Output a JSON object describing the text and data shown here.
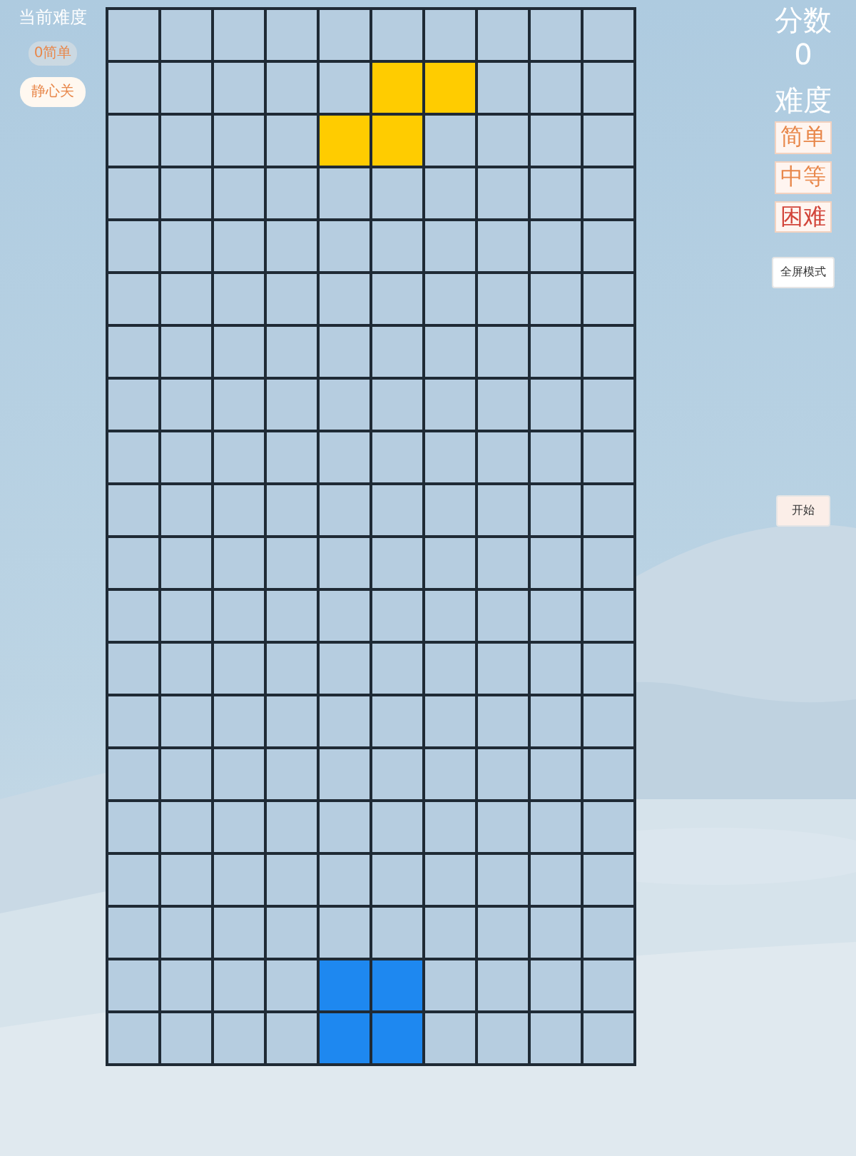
{
  "left_panel": {
    "title": "当前难度",
    "current_level": "0简单",
    "mode_button": "静心关"
  },
  "board": {
    "rows": [
      [
        {
          "filled": false
        },
        {
          "filled": false
        },
        {
          "filled": false
        },
        {
          "filled": false
        },
        {
          "filled": false
        },
        {
          "filled": false
        },
        {
          "filled": false
        },
        {
          "filled": false
        },
        {
          "filled": false
        },
        {
          "filled": false
        }
      ],
      [
        {
          "filled": false
        },
        {
          "filled": false
        },
        {
          "filled": false
        },
        {
          "filled": false
        },
        {
          "filled": false
        },
        {
          "filled": true,
          "color": "#ffcc00"
        },
        {
          "filled": true,
          "color": "#ffcc00"
        },
        {
          "filled": false
        },
        {
          "filled": false
        },
        {
          "filled": false
        }
      ],
      [
        {
          "filled": false
        },
        {
          "filled": false
        },
        {
          "filled": false
        },
        {
          "filled": false
        },
        {
          "filled": true,
          "color": "#ffcc00"
        },
        {
          "filled": true,
          "color": "#ffcc00"
        },
        {
          "filled": false
        },
        {
          "filled": false
        },
        {
          "filled": false
        },
        {
          "filled": false
        }
      ],
      [
        {
          "filled": false
        },
        {
          "filled": false
        },
        {
          "filled": false
        },
        {
          "filled": false
        },
        {
          "filled": false
        },
        {
          "filled": false
        },
        {
          "filled": false
        },
        {
          "filled": false
        },
        {
          "filled": false
        },
        {
          "filled": false
        }
      ],
      [
        {
          "filled": false
        },
        {
          "filled": false
        },
        {
          "filled": false
        },
        {
          "filled": false
        },
        {
          "filled": false
        },
        {
          "filled": false
        },
        {
          "filled": false
        },
        {
          "filled": false
        },
        {
          "filled": false
        },
        {
          "filled": false
        }
      ],
      [
        {
          "filled": false
        },
        {
          "filled": false
        },
        {
          "filled": false
        },
        {
          "filled": false
        },
        {
          "filled": false
        },
        {
          "filled": false
        },
        {
          "filled": false
        },
        {
          "filled": false
        },
        {
          "filled": false
        },
        {
          "filled": false
        }
      ],
      [
        {
          "filled": false
        },
        {
          "filled": false
        },
        {
          "filled": false
        },
        {
          "filled": false
        },
        {
          "filled": false
        },
        {
          "filled": false
        },
        {
          "filled": false
        },
        {
          "filled": false
        },
        {
          "filled": false
        },
        {
          "filled": false
        }
      ],
      [
        {
          "filled": false
        },
        {
          "filled": false
        },
        {
          "filled": false
        },
        {
          "filled": false
        },
        {
          "filled": false
        },
        {
          "filled": false
        },
        {
          "filled": false
        },
        {
          "filled": false
        },
        {
          "filled": false
        },
        {
          "filled": false
        }
      ],
      [
        {
          "filled": false
        },
        {
          "filled": false
        },
        {
          "filled": false
        },
        {
          "filled": false
        },
        {
          "filled": false
        },
        {
          "filled": false
        },
        {
          "filled": false
        },
        {
          "filled": false
        },
        {
          "filled": false
        },
        {
          "filled": false
        }
      ],
      [
        {
          "filled": false
        },
        {
          "filled": false
        },
        {
          "filled": false
        },
        {
          "filled": false
        },
        {
          "filled": false
        },
        {
          "filled": false
        },
        {
          "filled": false
        },
        {
          "filled": false
        },
        {
          "filled": false
        },
        {
          "filled": false
        }
      ],
      [
        {
          "filled": false
        },
        {
          "filled": false
        },
        {
          "filled": false
        },
        {
          "filled": false
        },
        {
          "filled": false
        },
        {
          "filled": false
        },
        {
          "filled": false
        },
        {
          "filled": false
        },
        {
          "filled": false
        },
        {
          "filled": false
        }
      ],
      [
        {
          "filled": false
        },
        {
          "filled": false
        },
        {
          "filled": false
        },
        {
          "filled": false
        },
        {
          "filled": false
        },
        {
          "filled": false
        },
        {
          "filled": false
        },
        {
          "filled": false
        },
        {
          "filled": false
        },
        {
          "filled": false
        }
      ],
      [
        {
          "filled": false
        },
        {
          "filled": false
        },
        {
          "filled": false
        },
        {
          "filled": false
        },
        {
          "filled": false
        },
        {
          "filled": false
        },
        {
          "filled": false
        },
        {
          "filled": false
        },
        {
          "filled": false
        },
        {
          "filled": false
        }
      ],
      [
        {
          "filled": false
        },
        {
          "filled": false
        },
        {
          "filled": false
        },
        {
          "filled": false
        },
        {
          "filled": false
        },
        {
          "filled": false
        },
        {
          "filled": false
        },
        {
          "filled": false
        },
        {
          "filled": false
        },
        {
          "filled": false
        }
      ],
      [
        {
          "filled": false
        },
        {
          "filled": false
        },
        {
          "filled": false
        },
        {
          "filled": false
        },
        {
          "filled": false
        },
        {
          "filled": false
        },
        {
          "filled": false
        },
        {
          "filled": false
        },
        {
          "filled": false
        },
        {
          "filled": false
        }
      ],
      [
        {
          "filled": false
        },
        {
          "filled": false
        },
        {
          "filled": false
        },
        {
          "filled": false
        },
        {
          "filled": false
        },
        {
          "filled": false
        },
        {
          "filled": false
        },
        {
          "filled": false
        },
        {
          "filled": false
        },
        {
          "filled": false
        }
      ],
      [
        {
          "filled": false
        },
        {
          "filled": false
        },
        {
          "filled": false
        },
        {
          "filled": false
        },
        {
          "filled": false
        },
        {
          "filled": false
        },
        {
          "filled": false
        },
        {
          "filled": false
        },
        {
          "filled": false
        },
        {
          "filled": false
        }
      ],
      [
        {
          "filled": false
        },
        {
          "filled": false
        },
        {
          "filled": false
        },
        {
          "filled": false
        },
        {
          "filled": false
        },
        {
          "filled": false
        },
        {
          "filled": false
        },
        {
          "filled": false
        },
        {
          "filled": false
        },
        {
          "filled": false
        }
      ],
      [
        {
          "filled": false
        },
        {
          "filled": false
        },
        {
          "filled": false
        },
        {
          "filled": false
        },
        {
          "filled": true,
          "color": "#1e88f0"
        },
        {
          "filled": true,
          "color": "#1e88f0"
        },
        {
          "filled": false
        },
        {
          "filled": false
        },
        {
          "filled": false
        },
        {
          "filled": false
        }
      ],
      [
        {
          "filled": false
        },
        {
          "filled": false
        },
        {
          "filled": false
        },
        {
          "filled": false
        },
        {
          "filled": true,
          "color": "#1e88f0"
        },
        {
          "filled": true,
          "color": "#1e88f0"
        },
        {
          "filled": false
        },
        {
          "filled": false
        },
        {
          "filled": false
        },
        {
          "filled": false
        }
      ]
    ]
  },
  "right_panel": {
    "score_label": "分数",
    "score": "0",
    "difficulty_label": "难度",
    "difficulties": [
      {
        "label": "简单",
        "color": "#e8874a"
      },
      {
        "label": "中等",
        "color": "#e8874a"
      },
      {
        "label": "困难",
        "color": "#d2453a"
      }
    ],
    "fullscreen_button": "全屏模式",
    "start_button": "开始"
  }
}
